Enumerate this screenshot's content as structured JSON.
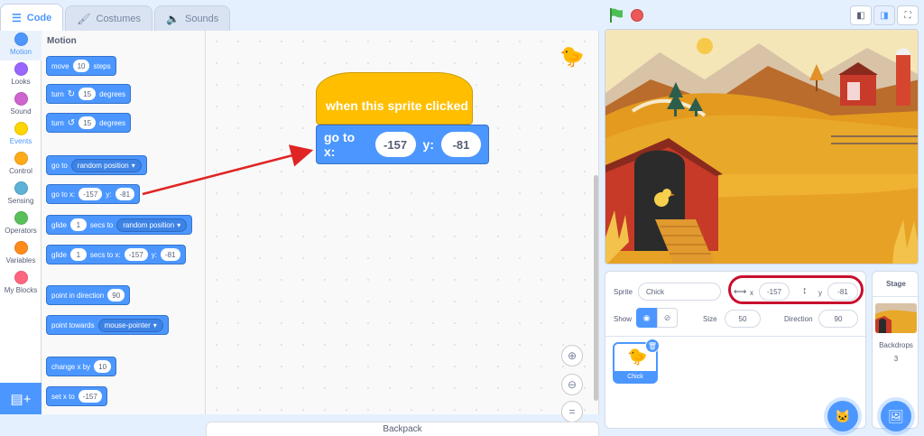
{
  "tabs": [
    {
      "label": "Code",
      "icon": "code-icon",
      "active": true
    },
    {
      "label": "Costumes",
      "icon": "brush-icon",
      "active": false
    },
    {
      "label": "Sounds",
      "icon": "speaker-icon",
      "active": false
    }
  ],
  "categories": [
    {
      "label": "Motion",
      "color": "#4c97ff",
      "selected": true
    },
    {
      "label": "Looks",
      "color": "#9966ff"
    },
    {
      "label": "Sound",
      "color": "#cf63cf"
    },
    {
      "label": "Events",
      "color": "#ffd500"
    },
    {
      "label": "Control",
      "color": "#ffab19"
    },
    {
      "label": "Sensing",
      "color": "#5cb1d6"
    },
    {
      "label": "Operators",
      "color": "#59c059"
    },
    {
      "label": "Variables",
      "color": "#ff8c1a"
    },
    {
      "label": "My Blocks",
      "color": "#ff6680"
    }
  ],
  "palette": {
    "title": "Motion",
    "move": {
      "label": "move",
      "value": "10",
      "suffix": "steps"
    },
    "turn_right": {
      "label": "turn",
      "value": "15",
      "suffix": "degrees"
    },
    "turn_left": {
      "label": "turn",
      "value": "15",
      "suffix": "degrees"
    },
    "goto": {
      "label": "go to",
      "option": "random position"
    },
    "goto_xy": {
      "label": "go to x:",
      "x": "-157",
      "ylabel": "y:",
      "y": "-81"
    },
    "glide_to": {
      "label": "glide",
      "value": "1",
      "mid": "secs to",
      "option": "random position"
    },
    "glide_xy": {
      "label": "glide",
      "value": "1",
      "mid": "secs to x:",
      "x": "-157",
      "ylabel": "y:",
      "y": "-81"
    },
    "point_dir": {
      "label": "point in direction",
      "value": "90"
    },
    "point_towards": {
      "label": "point towards",
      "option": "mouse-pointer"
    },
    "change_x": {
      "label": "change x by",
      "value": "10"
    },
    "set_x": {
      "label": "set x to",
      "value": "-157"
    }
  },
  "script": {
    "hat": "when this sprite clicked",
    "goto_label": "go to x:",
    "x": "-157",
    "ylabel": "y:",
    "y": "-81"
  },
  "backpack": "Backpack",
  "sprite_info": {
    "sprite_label": "Sprite",
    "sprite_name": "Chick",
    "x_label": "x",
    "x": "-157",
    "y_label": "y",
    "y": "-81",
    "show_label": "Show",
    "size_label": "Size",
    "size": "50",
    "direction_label": "Direction",
    "direction": "90"
  },
  "sprites": [
    {
      "name": "Chick"
    }
  ],
  "stage_pane": {
    "title": "Stage",
    "backdrops_label": "Backdrops",
    "backdrops_count": "3"
  },
  "colors": {
    "motion": "#4c97ff",
    "events": "#ffbf00",
    "highlight": "#c8102e"
  }
}
